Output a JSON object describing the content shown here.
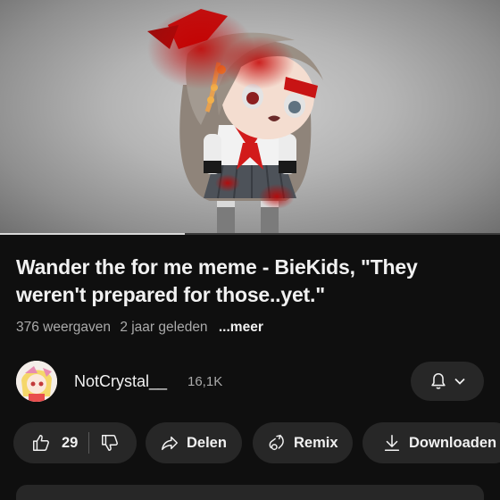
{
  "video": {
    "title": "Wander the for me meme - BieKids, \"They weren't prepared for those..yet.\"",
    "progress": 0.37
  },
  "meta": {
    "views": "376 weergaven",
    "age": "2 jaar geleden",
    "more": "...meer"
  },
  "channel": {
    "name": "NotCrystal__",
    "subscribers": "16,1K",
    "bell_icon": "bell-icon",
    "dropdown_icon": "chevron-down-icon"
  },
  "actions": {
    "likes": "29",
    "share": "Delen",
    "remix": "Remix",
    "download": "Downloaden"
  },
  "colors": {
    "background": "#0f0f0f",
    "pill": "#272727",
    "text": "#f1f1f1",
    "secondary_text": "#aaaaaa"
  }
}
